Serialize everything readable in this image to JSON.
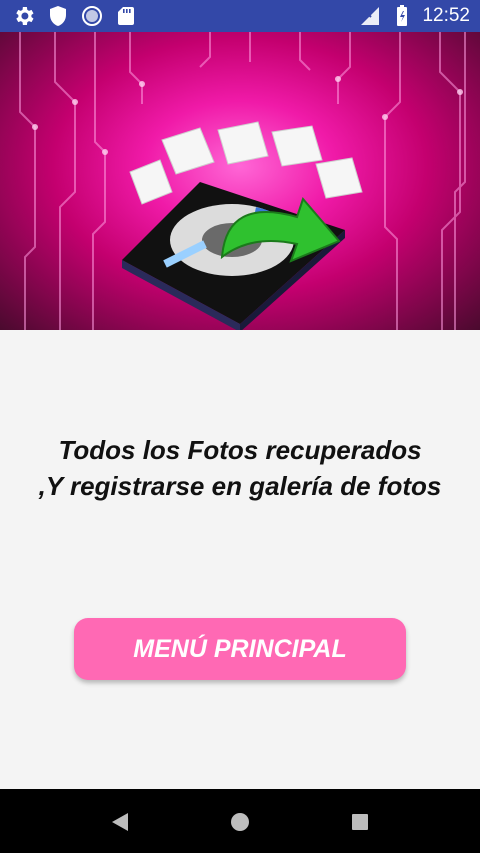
{
  "status_bar": {
    "time": "12:52",
    "left_icons": [
      "gear-icon",
      "shield-icon",
      "circle-dots-icon",
      "sd-card-icon"
    ],
    "right_icons": [
      "signal-icon",
      "battery-icon"
    ]
  },
  "banner": {
    "description_icon": "hard-drive-recovery-icon"
  },
  "message": {
    "line1": "Todos los Fotos recuperados",
    "line2": ",Y registrarse en galería de fotos"
  },
  "menu_button": {
    "label": "MENÚ PRINCIPAL",
    "color": "#ff69b4"
  },
  "nav_bar": {
    "buttons": [
      "back-icon",
      "home-icon",
      "recents-icon"
    ]
  },
  "colors": {
    "status_bar": "#3348a8",
    "background": "#f4f4f4",
    "banner_accent": "#f01aa8"
  }
}
